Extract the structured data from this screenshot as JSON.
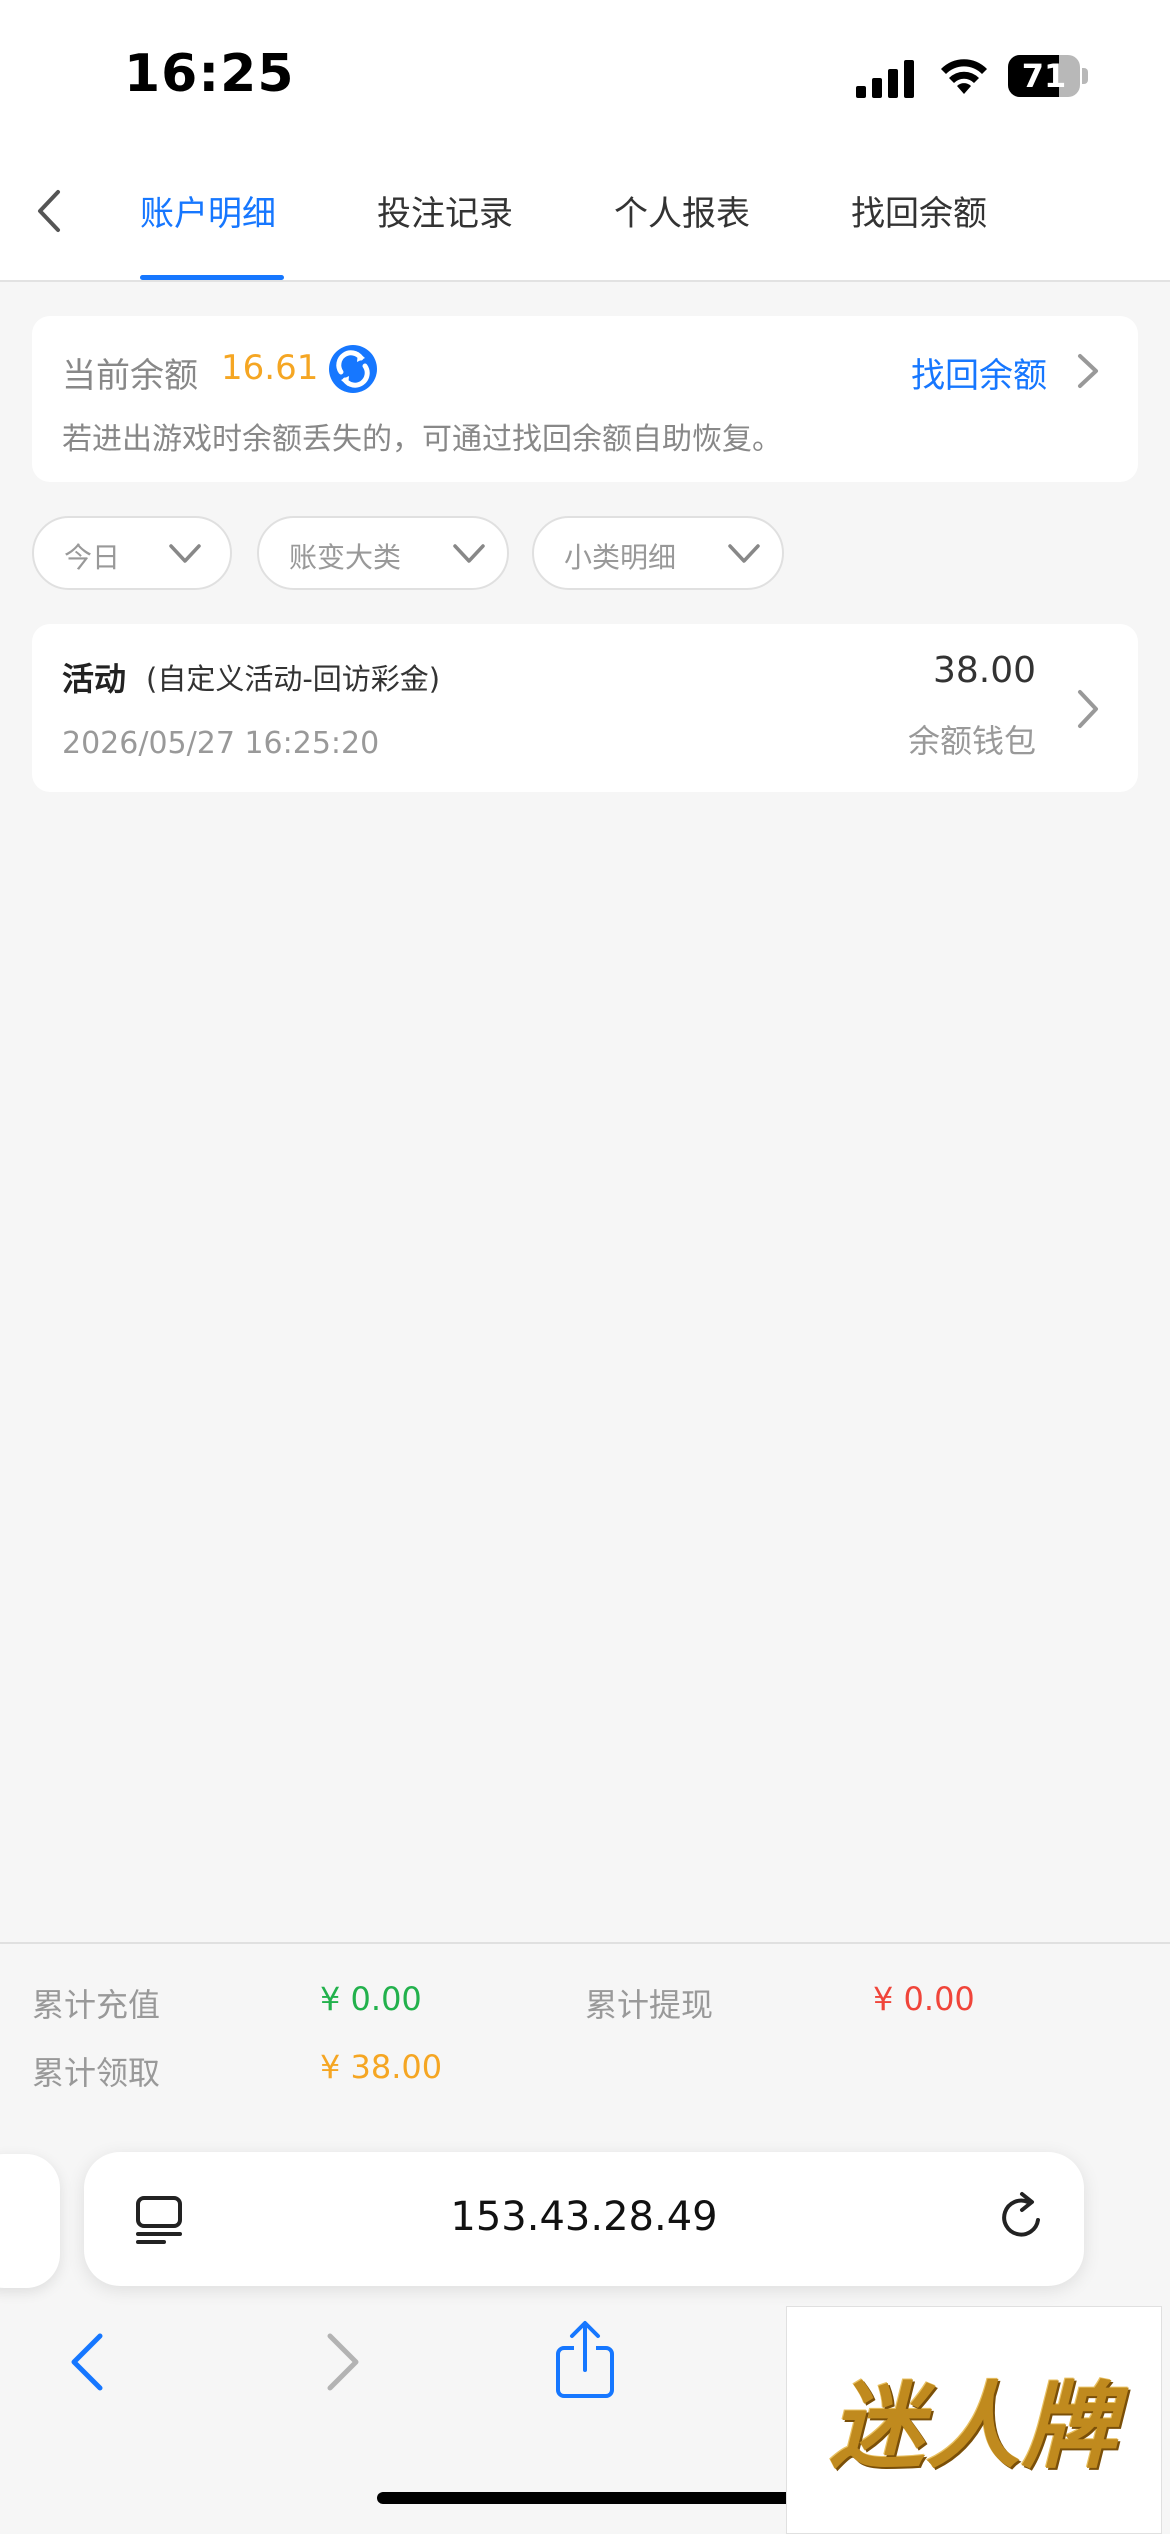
{
  "status_bar": {
    "time": "16:25",
    "battery_percent": "71",
    "battery_level": 0.71
  },
  "header": {
    "tabs": [
      {
        "label": "账户明细",
        "active": true
      },
      {
        "label": "投注记录",
        "active": false
      },
      {
        "label": "个人报表",
        "active": false
      },
      {
        "label": "找回余额",
        "active": false
      }
    ]
  },
  "balance": {
    "label": "当前余额",
    "value": "16.61",
    "recover_label": "找回余额",
    "hint": "若进出游戏时余额丢失的，可通过找回余额自助恢复。"
  },
  "filters": [
    {
      "label": "今日"
    },
    {
      "label": "账变大类"
    },
    {
      "label": "小类明细"
    }
  ],
  "records": [
    {
      "title": "活动",
      "subtitle": "(自定义活动-回访彩金)",
      "time": "2026/05/27 16:25:20",
      "amount": "38.00",
      "wallet": "余额钱包"
    }
  ],
  "totals": {
    "recharge_label": "累计充值",
    "recharge_value": "¥ 0.00",
    "withdraw_label": "累计提现",
    "withdraw_value": "¥ 0.00",
    "claim_label": "累计领取",
    "claim_value": "¥ 38.00"
  },
  "browser": {
    "url": "153.43.28.49"
  },
  "watermark": {
    "text": "迷人牌"
  },
  "colors": {
    "accent": "#1677ff",
    "balance": "#f5a623",
    "positive": "#22b14c",
    "negative": "#f0453a"
  }
}
